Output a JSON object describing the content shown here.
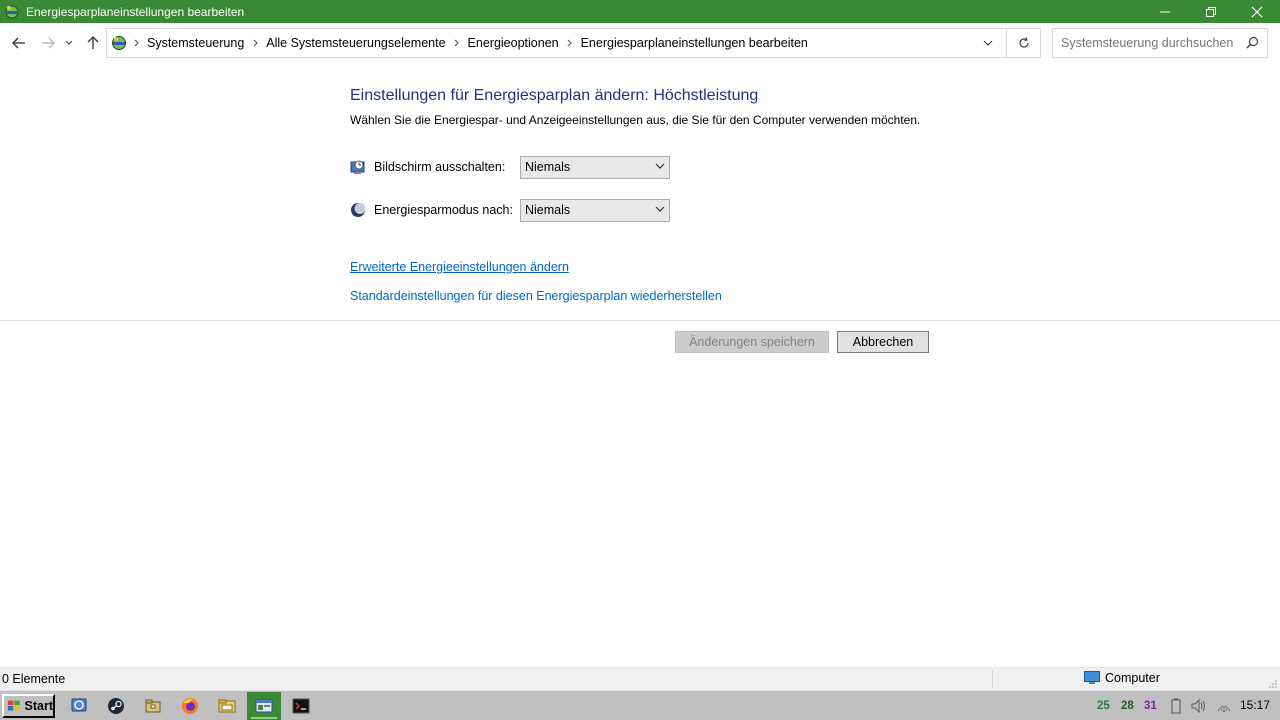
{
  "window": {
    "title": "Energiesparplaneinstellungen bearbeiten"
  },
  "breadcrumb": {
    "items": [
      "Systemsteuerung",
      "Alle Systemsteuerungselemente",
      "Energieoptionen",
      "Energiesparplaneinstellungen bearbeiten"
    ]
  },
  "search": {
    "placeholder": "Systemsteuerung durchsuchen"
  },
  "main": {
    "title": "Einstellungen für Energiesparplan ändern: Höchstleistung",
    "subtitle": "Wählen Sie die Energiespar- und Anzeigeeinstellungen aus, die Sie für den Computer verwenden möchten.",
    "display_off_label": "Bildschirm ausschalten:",
    "display_off_value": "Niemals",
    "sleep_label": "Energiesparmodus nach:",
    "sleep_value": "Niemals",
    "advanced_link": "Erweiterte Energieeinstellungen ändern",
    "restore_link": "Standardeinstellungen für diesen Energiesparplan wiederherstellen",
    "save_button": "Änderungen speichern",
    "cancel_button": "Abbrechen"
  },
  "statusbar": {
    "items_count": "0 Elemente",
    "location": "Computer"
  },
  "taskbar": {
    "start_label": "Start",
    "tray_num1": "25",
    "tray_num2": "28",
    "tray_num3": "31",
    "clock": "15:17"
  },
  "colors": {
    "titlebar": "#3a8a35",
    "heading": "#1e3287",
    "link": "#0066cc",
    "taskbar": "#c0c0c0"
  }
}
